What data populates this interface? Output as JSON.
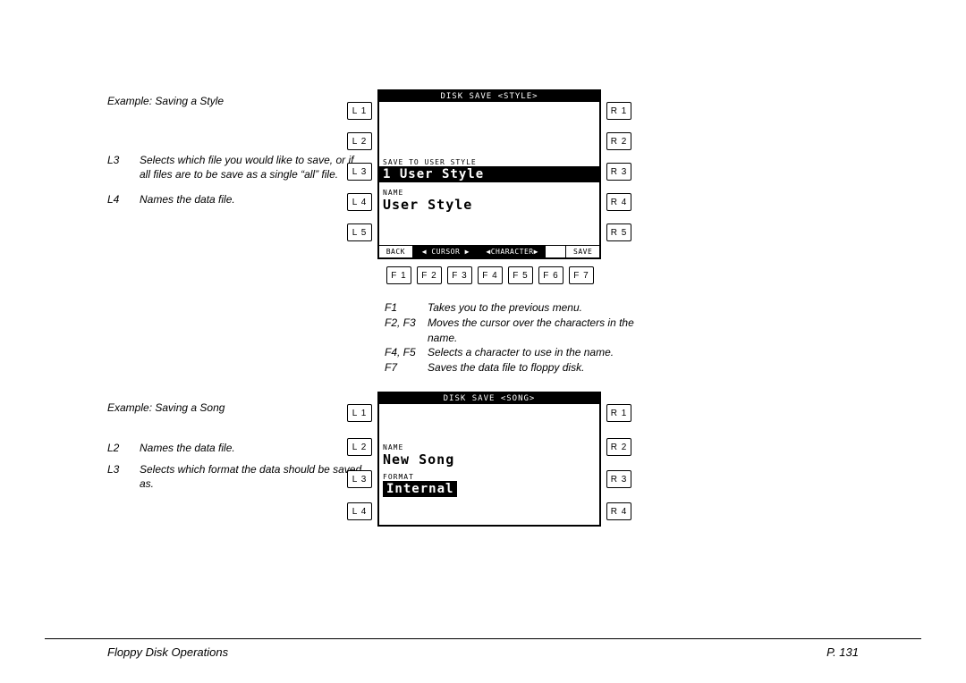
{
  "example1": {
    "heading": "Example: Saving a Style",
    "defs": [
      {
        "key": "L3",
        "val": "Selects which file you would like to save, or if all files are to be save as a single “all” file."
      },
      {
        "key": "L4",
        "val": "Names the data file."
      }
    ],
    "lcd": {
      "title": "DISK SAVE <STYLE>",
      "save_to_label": "SAVE TO USER STYLE",
      "item_inverted": "1 User Style",
      "name_label": "NAME",
      "name_value": "User Style",
      "footer": {
        "back": "BACK",
        "cursor": "◀ CURSOR ▶",
        "character": "◀CHARACTER▶",
        "save": "SAVE"
      }
    },
    "fbuttons": [
      "F 1",
      "F 2",
      "F 3",
      "F 4",
      "F 5",
      "F 6",
      "F 7"
    ],
    "lbuttons": [
      "L 1",
      "L 2",
      "L 3",
      "L 4",
      "L 5"
    ],
    "rbuttons": [
      "R 1",
      "R 2",
      "R 3",
      "R 4",
      "R 5"
    ],
    "fndesc": [
      {
        "key": "F1",
        "val": "Takes you to the previous menu."
      },
      {
        "key": "F2, F3",
        "val": "Moves the cursor over the characters in the name."
      },
      {
        "key": "F4, F5",
        "val": "Selects a character to use in the name."
      },
      {
        "key": "F7",
        "val": "Saves the data file to floppy disk."
      }
    ]
  },
  "example2": {
    "heading": "Example: Saving a Song",
    "defs": [
      {
        "key": "L2",
        "val": "Names the data file."
      },
      {
        "key": "L3",
        "val": "Selects which format the data should be saved as."
      }
    ],
    "lcd": {
      "title": "DISK SAVE <SONG>",
      "name_label": "NAME",
      "name_value": "New Song",
      "format_label": "FORMAT",
      "format_value": "Internal"
    },
    "lbuttons": [
      "L 1",
      "L 2",
      "L 3",
      "L 4"
    ],
    "rbuttons": [
      "R 1",
      "R 2",
      "R 3",
      "R 4"
    ]
  },
  "footer": {
    "left": "Floppy Disk Operations",
    "right": "P. 131"
  }
}
